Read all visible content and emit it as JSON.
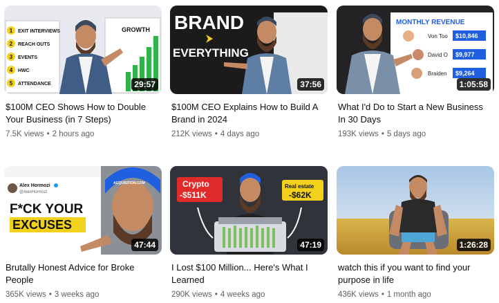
{
  "videos": [
    {
      "title": "$100M CEO Shows How to Double Your Business (in 7 Steps)",
      "views": "7.5K views",
      "age": "2 hours ago",
      "duration": "29:57",
      "thumb_text": {
        "list": [
          "EXIT INTERVIEWS",
          "REACH OUTS",
          "EVENTS",
          "HWC",
          "ATTENDANCE"
        ],
        "numbers": [
          "1",
          "2",
          "3",
          "4",
          "5"
        ],
        "board": "GROWTH"
      }
    },
    {
      "title": "$100M CEO Explains How to Build A Brand in 2024",
      "views": "212K views",
      "age": "4 days ago",
      "duration": "37:56",
      "thumb_text": {
        "line1": "BRAND",
        "line2": "EVERYTHING"
      }
    },
    {
      "title": "What I'd Do to Start a New Business In 30 Days",
      "views": "193K views",
      "age": "5 days ago",
      "duration": "1:05:58",
      "thumb_text": {
        "header": "MONTHLY REVENUE",
        "names": [
          "Von Too",
          "David O",
          "Braiden"
        ],
        "amounts": [
          "$10,846",
          "$9,977",
          "$9,264"
        ]
      }
    },
    {
      "title": "Brutally Honest Advice for Broke People",
      "views": "365K views",
      "age": "3 weeks ago",
      "duration": "47:44",
      "thumb_text": {
        "name": "Alex Hormozi",
        "handle": "@AlexHormozi",
        "line1": "F*CK YOUR",
        "line2": "EXCUSES",
        "hat": "ACQUISITION.COM"
      }
    },
    {
      "title": "I Lost $100 Million... Here's What I Learned",
      "views": "290K views",
      "age": "4 weeks ago",
      "duration": "47:19",
      "thumb_text": {
        "left_label": "Crypto",
        "left_value": "-$511K",
        "right_label": "Real estate",
        "right_value": "-$62K"
      }
    },
    {
      "title": "watch this if you want to find your purpose in life",
      "views": "436K views",
      "age": "1 month ago",
      "duration": "1:26:28"
    }
  ],
  "colors": {
    "title": "#0f0f0f",
    "meta": "#606060",
    "yellow": "#f2d11c",
    "red": "#e12b2b",
    "blue": "#1f5fe0"
  }
}
